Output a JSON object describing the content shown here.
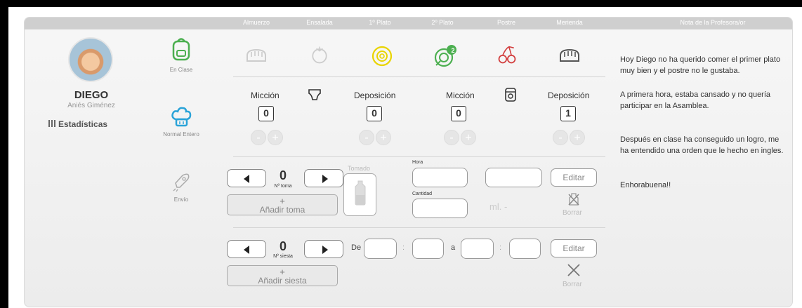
{
  "header": {
    "columns": [
      "Almuerzo",
      "Ensalada",
      "1º Plato",
      "2º Plato",
      "Postre",
      "Merienda",
      "Nota de la Profesora/or"
    ]
  },
  "student": {
    "first_name": "DIEGO",
    "last_name": "Aniés Giménez",
    "stats_label": "Estadísticas"
  },
  "status_icons": {
    "class_label": "En Clase",
    "food_label": "Normal Entero",
    "send_label": "Envío"
  },
  "meals": {
    "second_course_badge": "2"
  },
  "hygiene": {
    "diaper": {
      "miccion_label": "Micción",
      "deposicion_label": "Deposición",
      "miccion_value": "0",
      "deposicion_value": "0"
    },
    "potty": {
      "miccion_label": "Micción",
      "deposicion_label": "Deposición",
      "miccion_value": "0",
      "deposicion_value": "1"
    },
    "minus": "-",
    "plus": "+"
  },
  "bottle": {
    "count": "0",
    "count_label": "Nº toma",
    "add_label": "Añadir toma",
    "add_plus": "+",
    "taken_label": "Tomado",
    "hour_label": "Hora",
    "amount_label": "Cantidad",
    "unit_label": "ml. -",
    "edit_label": "Editar",
    "delete_label": "Borrar"
  },
  "nap": {
    "count": "0",
    "count_label": "Nº siesta",
    "add_label": "Añadir siesta",
    "add_plus": "+",
    "from_label": "De",
    "to_label": "a",
    "separator": ":",
    "edit_label": "Editar",
    "delete_label": "Borrar"
  },
  "teacher_note": {
    "p1": "Hoy Diego no ha querido comer el primer plato muy bien  y el postre no le gustaba.",
    "p2": "A primera hora, estaba cansado y no quería participar en la Asamblea.",
    "p3": "Después en clase ha conseguido un logro, me ha entendido una orden que le hecho en ingles.",
    "p4": "Enhorabuena!!"
  },
  "colors": {
    "green": "#4caf50",
    "yellow": "#e9d400",
    "red": "#d23c3c",
    "blue": "#2aa3d8"
  }
}
